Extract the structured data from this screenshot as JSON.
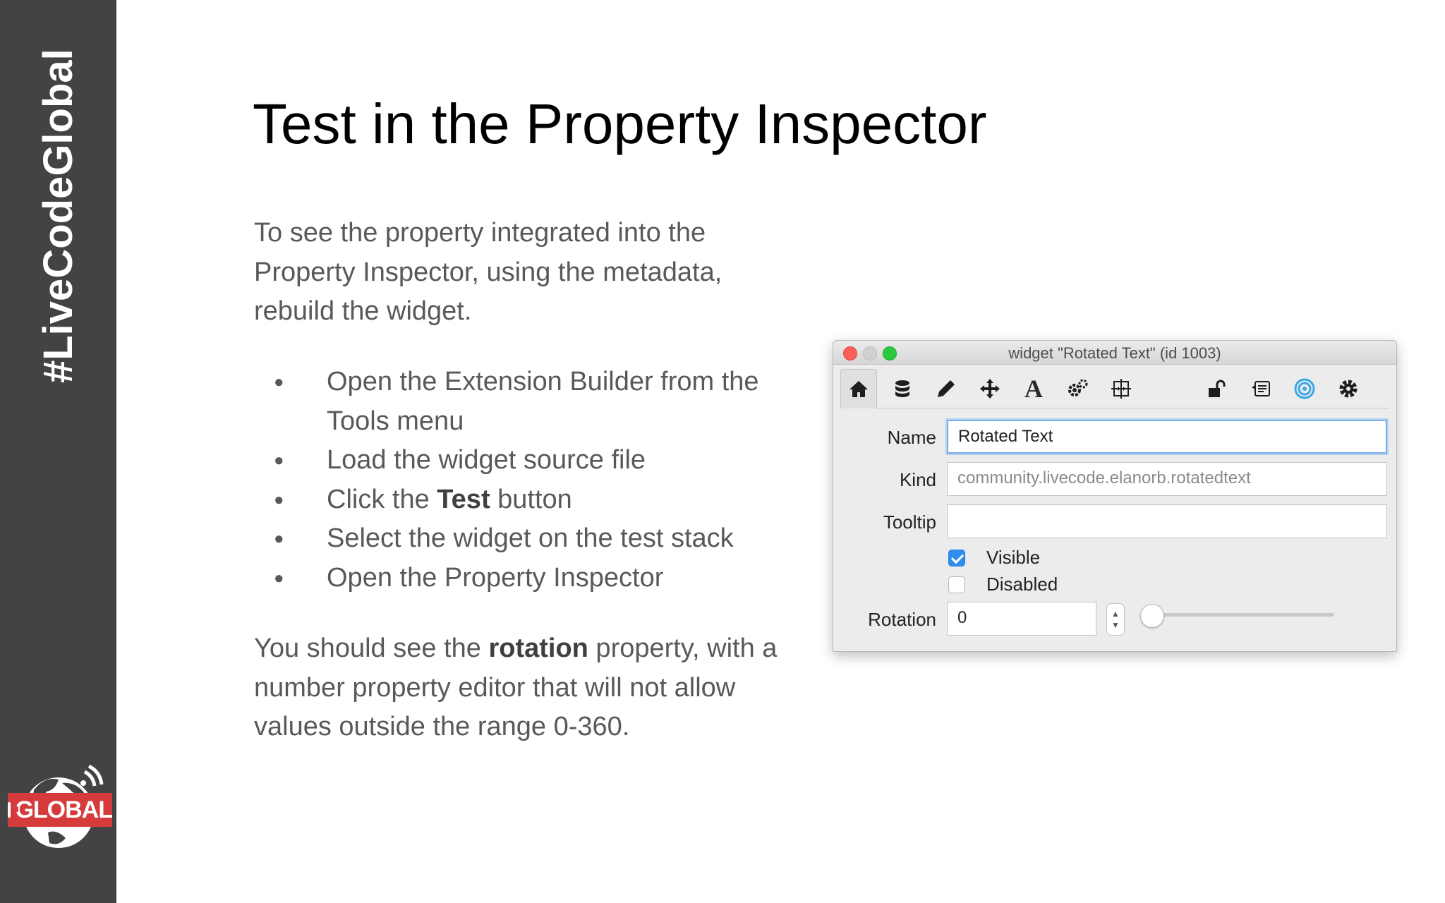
{
  "sidebar": {
    "hashtag": "#LiveCodeGlobal",
    "logo_text": "GLOBAL"
  },
  "slide": {
    "title": "Test in the Property Inspector",
    "intro": "To see the property integrated into the Property Inspector, using the metadata, rebuild the widget.",
    "bullets": [
      "Open the Extension Builder from the Tools menu",
      "Load the widget source file",
      {
        "pre": "Click the ",
        "bold": "Test",
        "post": " button"
      },
      "Select the widget on the test stack",
      "Open the Property Inspector"
    ],
    "outro": {
      "pre": "You should see the ",
      "bold": "rotation",
      "post": " property, with a number property editor that will not allow values outside the range 0-360."
    }
  },
  "inspector": {
    "window_title": "widget \"Rotated Text\" (id 1003)",
    "toolbar_icons": [
      "home-icon",
      "database-icon",
      "pencil-icon",
      "move-icon",
      "text-icon",
      "gears-icon",
      "resize-icon",
      "unlock-icon",
      "script-icon",
      "target-icon",
      "gear-icon"
    ],
    "name_label": "Name",
    "name_value": "Rotated Text",
    "kind_label": "Kind",
    "kind_value": "community.livecode.elanorb.rotatedtext",
    "tooltip_label": "Tooltip",
    "tooltip_value": "",
    "visible_label": "Visible",
    "visible_checked": true,
    "disabled_label": "Disabled",
    "disabled_checked": false,
    "rotation_label": "Rotation",
    "rotation_value": "0",
    "rotation_slider_level": 0
  },
  "colors": {
    "sidebar_bg": "#434343",
    "logo_red": "#d63b3b",
    "checkbox_blue": "#2f8df0"
  }
}
